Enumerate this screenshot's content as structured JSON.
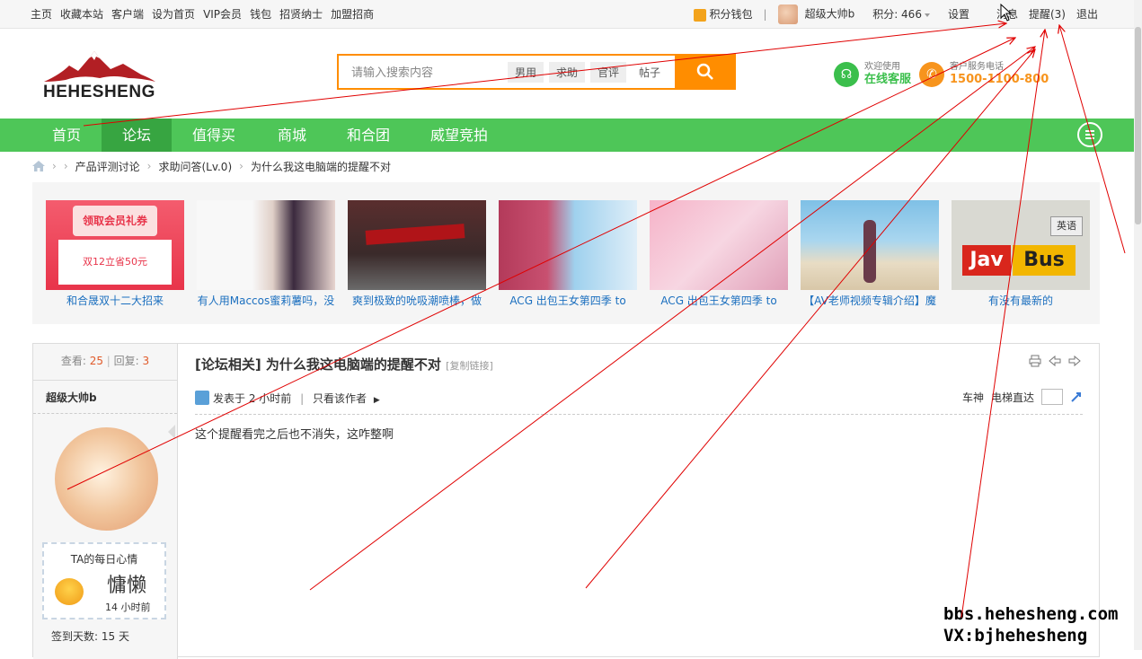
{
  "topbar": {
    "left_links": [
      "主页",
      "收藏本站",
      "客户端",
      "设为首页",
      "VIP会员",
      "钱包",
      "招贤纳士",
      "加盟招商"
    ],
    "wallet": "积分钱包",
    "divider": "|",
    "username": "超级大帅b",
    "points": "积分: 466",
    "settings": "设置",
    "messages": "消息",
    "reminders": "提醒(3)",
    "logout": "退出"
  },
  "header": {
    "logo_text": "HEHESHENG",
    "search_placeholder": "请输入搜索内容",
    "search_tags": [
      "男用",
      "求助",
      "官评",
      "帖子"
    ],
    "service_welcome": "欢迎使用",
    "service_label": "在线客服",
    "phone_label": "客户服务电话",
    "phone_number": "1500-1100-800"
  },
  "nav": {
    "items": [
      "首页",
      "论坛",
      "值得买",
      "商城",
      "和合团",
      "威望竞拍"
    ],
    "active": "论坛"
  },
  "breadcrumb": {
    "items": [
      "产品评测讨论",
      "求助问答(Lv.0)",
      "为什么我这电脑端的提醒不对"
    ]
  },
  "gallery": [
    {
      "caption": "和合晟双十二大招来"
    },
    {
      "caption": "有人用Maccos蜜莉薯吗，没"
    },
    {
      "caption": "爽到极致的吮吸潮喷棒，做"
    },
    {
      "caption": "ACG 出包王女第四季 to"
    },
    {
      "caption": "ACG 出包王女第四季 to"
    },
    {
      "caption": "【AV老师视频专辑介绍】魔"
    },
    {
      "caption": "有没有最新的"
    }
  ],
  "gallery_img_text": {
    "coupon_top": "领取会员礼券",
    "coupon_bottom": "双12立省50元",
    "jav_left": "Jav",
    "jav_right": "Bus",
    "jav_top": "英语"
  },
  "post": {
    "views_label": "查看:",
    "views": "25",
    "replies_label": "回复:",
    "replies": "3",
    "title": "[论坛相关] 为什么我这电脑端的提醒不对",
    "copy_link": "[复制链接]",
    "author": "超级大帅b",
    "posted": "发表于 2 小时前",
    "only_author": "只看该作者",
    "back_to_top": "车神",
    "elevator": "电梯直达",
    "content": "这个提醒看完之后也不消失，这咋整啊",
    "mood_title": "TA的每日心情",
    "mood": "慵懒",
    "mood_time": "14 小时前",
    "sign_days": "签到天数: 15 天"
  },
  "watermark": {
    "line1": "bbs.hehesheng.com",
    "line2": "VX:bjhehesheng"
  },
  "colors": {
    "nav_green": "#4ec658",
    "nav_active": "#37a541",
    "search_orange": "#ff8d00",
    "link_blue": "#1b6fbf",
    "annotation_red": "#e00000"
  }
}
